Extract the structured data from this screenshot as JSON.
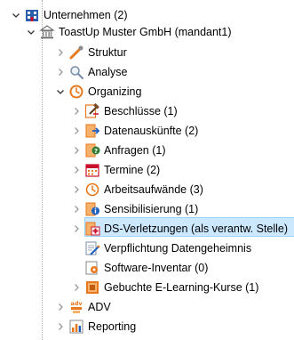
{
  "tree": {
    "root": {
      "label": "Unternehmen (2)",
      "icon": "company-icon"
    },
    "mandant": {
      "label": "ToastUp Muster GmbH (mandant1)",
      "icon": "building-icon"
    },
    "struktur": {
      "label": "Struktur",
      "icon": "structure-icon"
    },
    "analyse": {
      "label": "Analyse",
      "icon": "magnifier-icon"
    },
    "organizing": {
      "label": "Organizing",
      "icon": "organizing-icon"
    },
    "items": [
      {
        "label": "Beschlüsse (1)",
        "icon": "gavel-icon"
      },
      {
        "label": "Datenauskünfte (2)",
        "icon": "data-info-icon"
      },
      {
        "label": "Anfragen (1)",
        "icon": "inquiry-icon"
      },
      {
        "label": "Termine (2)",
        "icon": "calendar-icon"
      },
      {
        "label": "Arbeitsaufwände (3)",
        "icon": "clock-icon"
      },
      {
        "label": "Sensibilisierung (1)",
        "icon": "awareness-icon"
      },
      {
        "label": "DS-Verletzungen (als verantw. Stelle)",
        "icon": "breach-icon",
        "selected": true
      },
      {
        "label": "Verpflichtung Datengeheimnis",
        "icon": "commitment-icon"
      },
      {
        "label": "Software-Inventar (0)",
        "icon": "software-icon"
      },
      {
        "label": "Gebuchte E-Learning-Kurse (1)",
        "icon": "elearning-icon"
      }
    ],
    "adv": {
      "label": "ADV",
      "icon": "adv-icon",
      "badge": "adv"
    },
    "reporting": {
      "label": "Reporting",
      "icon": "reporting-icon"
    }
  },
  "colors": {
    "selection": "#cce8ff",
    "selection_border": "#99d1ff",
    "accent_orange": "#e8781e",
    "blue": "#1e5fbf"
  }
}
